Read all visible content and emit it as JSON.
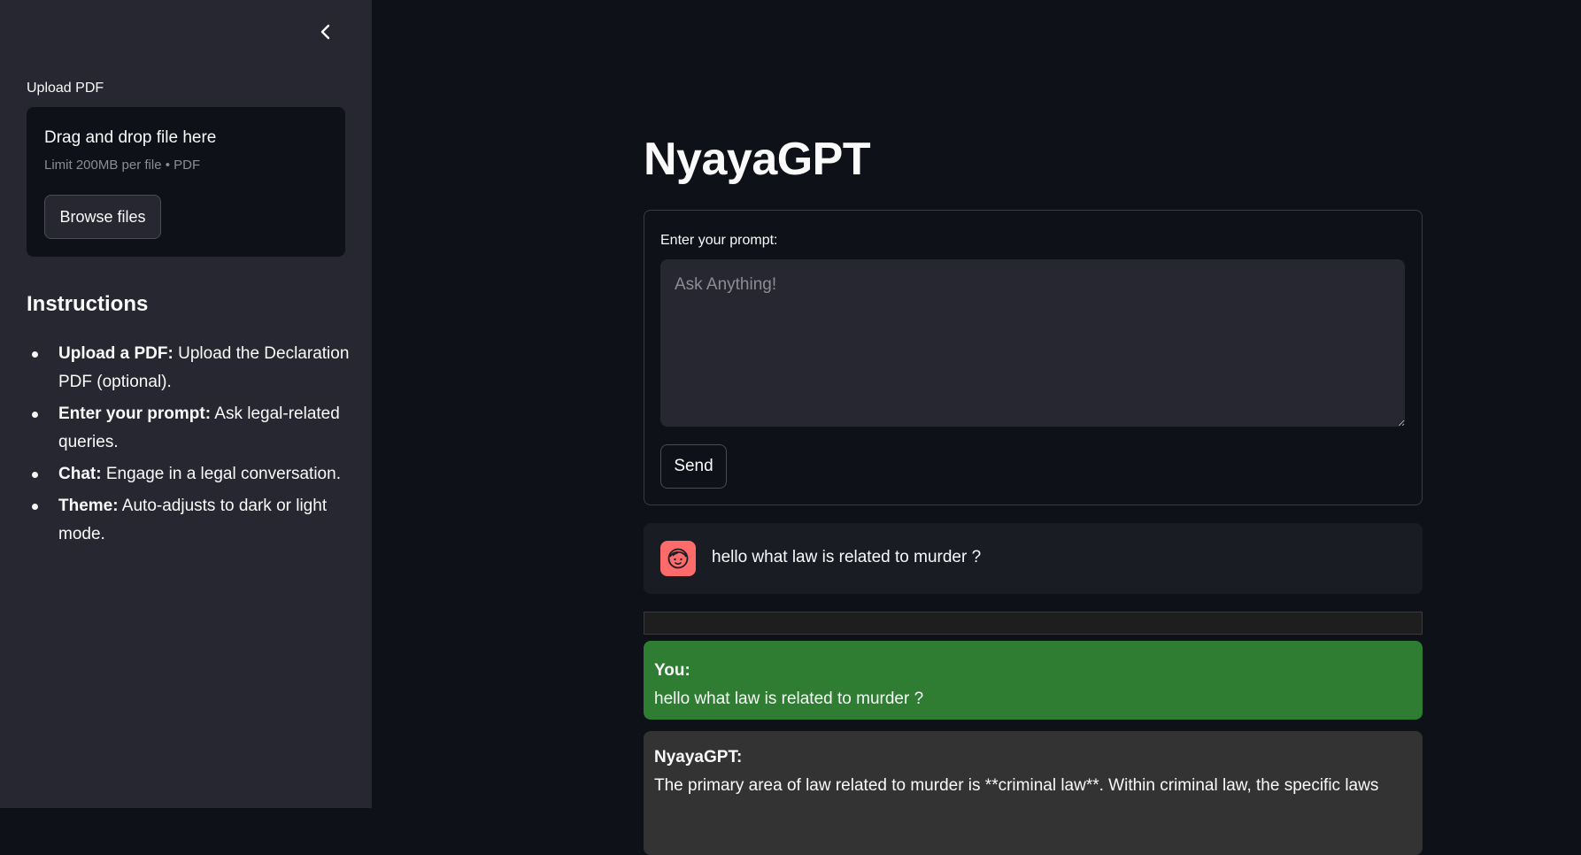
{
  "sidebar": {
    "upload_label": "Upload PDF",
    "dropzone": {
      "title": "Drag and drop file here",
      "limit": "Limit 200MB per file • PDF",
      "browse_label": "Browse files"
    },
    "instructions_title": "Instructions",
    "instructions": [
      {
        "bold": "Upload a PDF:",
        "text": " Upload the Declaration PDF (optional)."
      },
      {
        "bold": "Enter your prompt:",
        "text": " Ask legal-related queries."
      },
      {
        "bold": "Chat:",
        "text": " Engage in a legal conversation."
      },
      {
        "bold": "Theme:",
        "text": " Auto-adjusts to dark or light mode."
      }
    ],
    "collapse_icon": "chevron-left-icon"
  },
  "main": {
    "title": "NyayaGPT",
    "form": {
      "prompt_label": "Enter your prompt:",
      "prompt_placeholder": "Ask Anything!",
      "prompt_value": "",
      "send_label": "Send"
    },
    "user_message": {
      "avatar_icon": "face-icon",
      "text": "hello what law is related to murder ?"
    },
    "history": [
      {
        "speaker": "You:",
        "text": "hello what law is related to murder ?"
      },
      {
        "speaker": "NyayaGPT:",
        "text": "The primary area of law related to murder is **criminal law**. Within criminal law, the specific laws"
      }
    ]
  },
  "colors": {
    "sidebar_bg": "#262730",
    "main_bg": "#0e1117",
    "user_bubble": "#2e7d32",
    "bot_bubble": "#333333",
    "avatar_bg": "#ff6b6b"
  }
}
